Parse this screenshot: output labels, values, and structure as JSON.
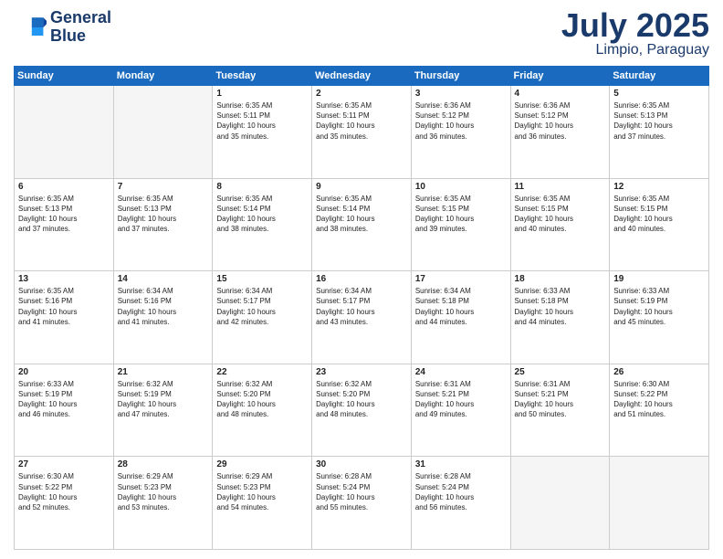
{
  "logo": {
    "line1": "General",
    "line2": "Blue"
  },
  "title": "July 2025",
  "subtitle": "Limpio, Paraguay",
  "days_header": [
    "Sunday",
    "Monday",
    "Tuesday",
    "Wednesday",
    "Thursday",
    "Friday",
    "Saturday"
  ],
  "weeks": [
    [
      {
        "num": "",
        "info": ""
      },
      {
        "num": "",
        "info": ""
      },
      {
        "num": "1",
        "info": "Sunrise: 6:35 AM\nSunset: 5:11 PM\nDaylight: 10 hours\nand 35 minutes."
      },
      {
        "num": "2",
        "info": "Sunrise: 6:35 AM\nSunset: 5:11 PM\nDaylight: 10 hours\nand 35 minutes."
      },
      {
        "num": "3",
        "info": "Sunrise: 6:36 AM\nSunset: 5:12 PM\nDaylight: 10 hours\nand 36 minutes."
      },
      {
        "num": "4",
        "info": "Sunrise: 6:36 AM\nSunset: 5:12 PM\nDaylight: 10 hours\nand 36 minutes."
      },
      {
        "num": "5",
        "info": "Sunrise: 6:35 AM\nSunset: 5:13 PM\nDaylight: 10 hours\nand 37 minutes."
      }
    ],
    [
      {
        "num": "6",
        "info": "Sunrise: 6:35 AM\nSunset: 5:13 PM\nDaylight: 10 hours\nand 37 minutes."
      },
      {
        "num": "7",
        "info": "Sunrise: 6:35 AM\nSunset: 5:13 PM\nDaylight: 10 hours\nand 37 minutes."
      },
      {
        "num": "8",
        "info": "Sunrise: 6:35 AM\nSunset: 5:14 PM\nDaylight: 10 hours\nand 38 minutes."
      },
      {
        "num": "9",
        "info": "Sunrise: 6:35 AM\nSunset: 5:14 PM\nDaylight: 10 hours\nand 38 minutes."
      },
      {
        "num": "10",
        "info": "Sunrise: 6:35 AM\nSunset: 5:15 PM\nDaylight: 10 hours\nand 39 minutes."
      },
      {
        "num": "11",
        "info": "Sunrise: 6:35 AM\nSunset: 5:15 PM\nDaylight: 10 hours\nand 40 minutes."
      },
      {
        "num": "12",
        "info": "Sunrise: 6:35 AM\nSunset: 5:15 PM\nDaylight: 10 hours\nand 40 minutes."
      }
    ],
    [
      {
        "num": "13",
        "info": "Sunrise: 6:35 AM\nSunset: 5:16 PM\nDaylight: 10 hours\nand 41 minutes."
      },
      {
        "num": "14",
        "info": "Sunrise: 6:34 AM\nSunset: 5:16 PM\nDaylight: 10 hours\nand 41 minutes."
      },
      {
        "num": "15",
        "info": "Sunrise: 6:34 AM\nSunset: 5:17 PM\nDaylight: 10 hours\nand 42 minutes."
      },
      {
        "num": "16",
        "info": "Sunrise: 6:34 AM\nSunset: 5:17 PM\nDaylight: 10 hours\nand 43 minutes."
      },
      {
        "num": "17",
        "info": "Sunrise: 6:34 AM\nSunset: 5:18 PM\nDaylight: 10 hours\nand 44 minutes."
      },
      {
        "num": "18",
        "info": "Sunrise: 6:33 AM\nSunset: 5:18 PM\nDaylight: 10 hours\nand 44 minutes."
      },
      {
        "num": "19",
        "info": "Sunrise: 6:33 AM\nSunset: 5:19 PM\nDaylight: 10 hours\nand 45 minutes."
      }
    ],
    [
      {
        "num": "20",
        "info": "Sunrise: 6:33 AM\nSunset: 5:19 PM\nDaylight: 10 hours\nand 46 minutes."
      },
      {
        "num": "21",
        "info": "Sunrise: 6:32 AM\nSunset: 5:19 PM\nDaylight: 10 hours\nand 47 minutes."
      },
      {
        "num": "22",
        "info": "Sunrise: 6:32 AM\nSunset: 5:20 PM\nDaylight: 10 hours\nand 48 minutes."
      },
      {
        "num": "23",
        "info": "Sunrise: 6:32 AM\nSunset: 5:20 PM\nDaylight: 10 hours\nand 48 minutes."
      },
      {
        "num": "24",
        "info": "Sunrise: 6:31 AM\nSunset: 5:21 PM\nDaylight: 10 hours\nand 49 minutes."
      },
      {
        "num": "25",
        "info": "Sunrise: 6:31 AM\nSunset: 5:21 PM\nDaylight: 10 hours\nand 50 minutes."
      },
      {
        "num": "26",
        "info": "Sunrise: 6:30 AM\nSunset: 5:22 PM\nDaylight: 10 hours\nand 51 minutes."
      }
    ],
    [
      {
        "num": "27",
        "info": "Sunrise: 6:30 AM\nSunset: 5:22 PM\nDaylight: 10 hours\nand 52 minutes."
      },
      {
        "num": "28",
        "info": "Sunrise: 6:29 AM\nSunset: 5:23 PM\nDaylight: 10 hours\nand 53 minutes."
      },
      {
        "num": "29",
        "info": "Sunrise: 6:29 AM\nSunset: 5:23 PM\nDaylight: 10 hours\nand 54 minutes."
      },
      {
        "num": "30",
        "info": "Sunrise: 6:28 AM\nSunset: 5:24 PM\nDaylight: 10 hours\nand 55 minutes."
      },
      {
        "num": "31",
        "info": "Sunrise: 6:28 AM\nSunset: 5:24 PM\nDaylight: 10 hours\nand 56 minutes."
      },
      {
        "num": "",
        "info": ""
      },
      {
        "num": "",
        "info": ""
      }
    ]
  ]
}
